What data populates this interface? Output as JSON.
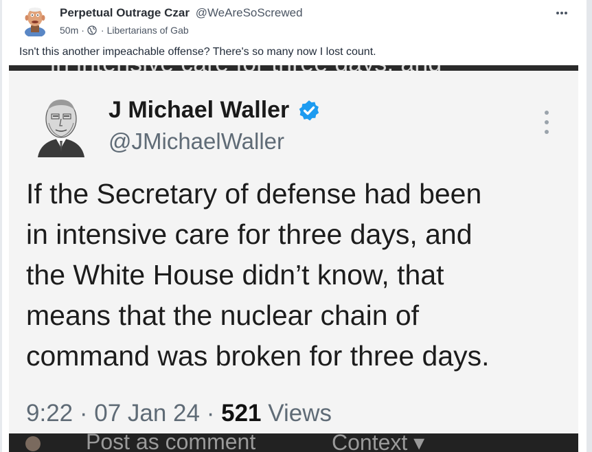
{
  "post": {
    "author_name": "Perpetual Outrage Czar",
    "author_handle": "@WeAreSoScrewed",
    "time_ago": "50m",
    "separator": "·",
    "group_name": "Libertarians of Gab",
    "body": "Isn't this another impeachable offense? There's so many now I lost count."
  },
  "embed": {
    "top_strip_text": "in intensive care for three days, and",
    "tweet": {
      "name": "J Michael Waller",
      "handle": "@JMichaelWaller",
      "body_lines": [
        "If the Secretary of defense had been",
        "in intensive care for three days, and",
        "the White House didn’t know, that",
        "means that the nuclear chain of",
        "command was broken for three days."
      ],
      "time": "9:22",
      "date": "07 Jan 24",
      "separator": "·",
      "views_count": "521",
      "views_label": "Views"
    },
    "bottom_bar": {
      "comment_label": "Post as comment",
      "context_label": "Context ▾"
    }
  },
  "icons": {
    "more": "more-horizontal-icon",
    "globe": "globe-icon",
    "verified": "verified-badge-icon",
    "tweet_more": "more-vertical-icon"
  },
  "colors": {
    "verified_blue": "#1d9bf0",
    "text_dark": "#1f2937",
    "text_muted": "#4b5563",
    "embed_bg": "#f4f4f4",
    "bottom_bar": "#222222"
  }
}
